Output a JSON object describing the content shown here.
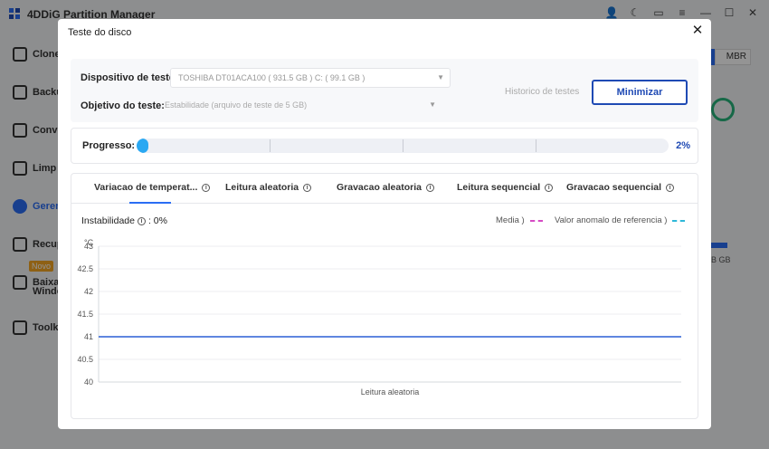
{
  "app": {
    "title": "4DDiG Partition Manager",
    "sidebar": [
      {
        "label": "Clone"
      },
      {
        "label": "Backu"
      },
      {
        "label": "Conve"
      },
      {
        "label": "Limp"
      },
      {
        "label": "Geren"
      },
      {
        "label": "Recup"
      },
      {
        "label": "Baixa"
      },
      {
        "label": "Windo"
      },
      {
        "label": "Toolki"
      }
    ],
    "new_badge": "Novo",
    "right": {
      "mbr": "MBR",
      "size": "B GB"
    }
  },
  "modal": {
    "title": "Teste do disco",
    "device_label": "Dispositivo de teste:",
    "device_value": "TOSHIBA DT01ACA100 ( 931.5 GB )  C:  ( 99.1 GB )",
    "objective_label": "Objetivo do teste:",
    "objective_value": "Estabilidade (arquivo de teste de 5 GB)",
    "history_link": "Historico de testes",
    "minimize_label": "Minimizar",
    "progress_label": "Progresso:",
    "progress_value": 2,
    "progress_text": "2%",
    "tabs": [
      {
        "label": "Variacao de temperat..."
      },
      {
        "label": "Leitura aleatoria"
      },
      {
        "label": "Gravacao aleatoria"
      },
      {
        "label": "Leitura sequencial"
      },
      {
        "label": "Gravacao sequencial"
      }
    ],
    "active_tab": 0,
    "instability_label": "Instabilidade",
    "instability_value": ": 0%",
    "legend": [
      {
        "label": "Media )",
        "color": "#d64bc4"
      },
      {
        "label": "Valor anomalo de referencia )",
        "color": "#2fb8d9"
      }
    ]
  },
  "chart_data": {
    "type": "line",
    "ylabel": "°C",
    "xlabel": "Leitura aleatoria",
    "ylim": [
      40,
      43
    ],
    "yticks": [
      "43",
      "42.5",
      "42",
      "41.5",
      "41",
      "40.5",
      "40"
    ],
    "grid": true,
    "series": [
      {
        "values": [
          41,
          41
        ],
        "color": "#2a5fd6"
      }
    ]
  }
}
